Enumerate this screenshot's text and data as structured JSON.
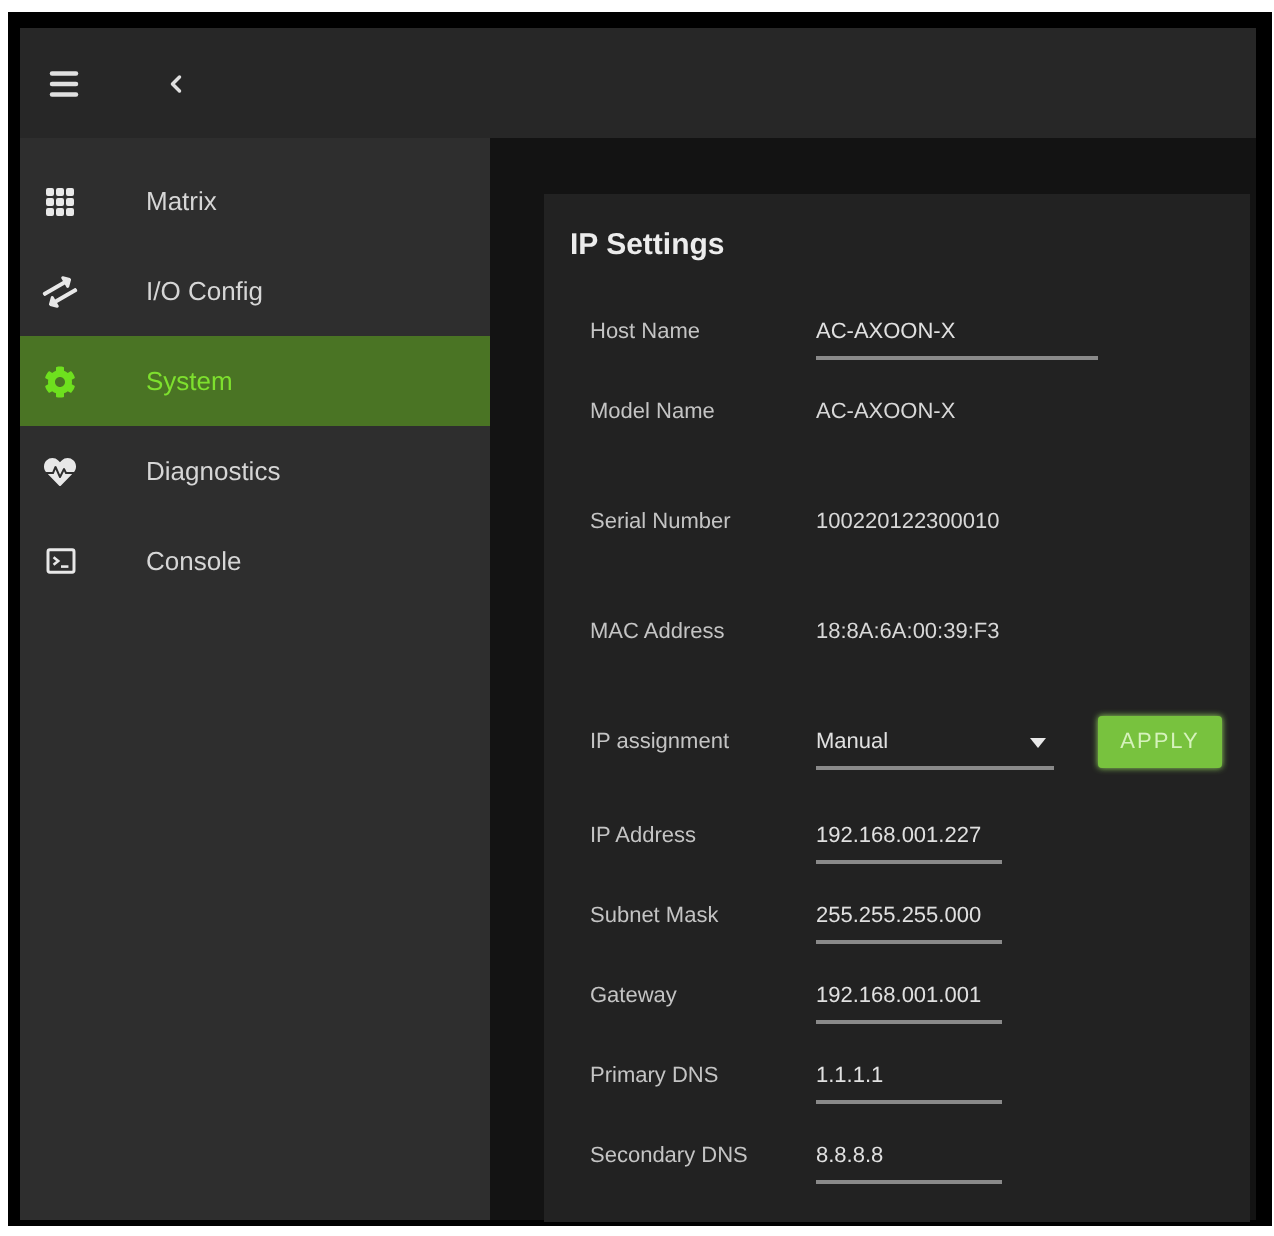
{
  "sidebar": {
    "items": [
      {
        "label": "Matrix",
        "selected": false
      },
      {
        "label": "I/O Config",
        "selected": false
      },
      {
        "label": "System",
        "selected": true
      },
      {
        "label": "Diagnostics",
        "selected": false
      },
      {
        "label": "Console",
        "selected": false
      }
    ]
  },
  "card": {
    "title": "IP Settings",
    "fields": [
      {
        "label": "Host Name",
        "value": "AC-AXOON-X",
        "kind": "input"
      },
      {
        "label": "Model Name",
        "value": "AC-AXOON-X",
        "kind": "text"
      },
      {
        "label": "Serial Number",
        "value": "100220122300010",
        "kind": "text"
      },
      {
        "label": "MAC Address",
        "value": "18:8A:6A:00:39:F3",
        "kind": "text"
      },
      {
        "label": "IP assignment",
        "value": "Manual",
        "kind": "select"
      },
      {
        "label": "IP Address",
        "value": "192.168.001.227",
        "kind": "input"
      },
      {
        "label": "Subnet Mask",
        "value": "255.255.255.000",
        "kind": "input"
      },
      {
        "label": "Gateway",
        "value": "192.168.001.001",
        "kind": "input"
      },
      {
        "label": "Primary DNS",
        "value": "1.1.1.1",
        "kind": "input"
      },
      {
        "label": "Secondary DNS",
        "value": "8.8.8.8",
        "kind": "input"
      }
    ],
    "apply_button": {
      "label": "APPLY"
    }
  }
}
